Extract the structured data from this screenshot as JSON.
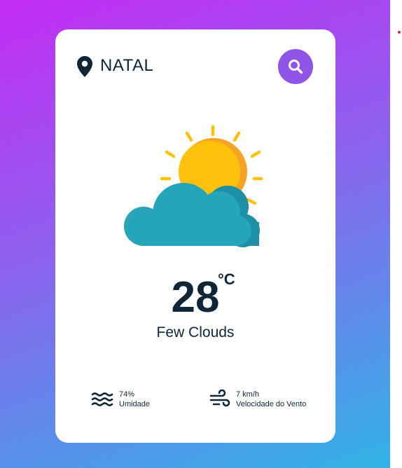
{
  "location": {
    "city": "NATAL",
    "icon": "location-pin-icon"
  },
  "search": {
    "icon": "search-icon"
  },
  "weather": {
    "icon": "sun-behind-cloud-icon",
    "temperature": "28",
    "unit": "°C",
    "description": "Few Clouds"
  },
  "details": {
    "humidity": {
      "icon": "waves-icon",
      "value": "74%",
      "label": "Umidade"
    },
    "wind": {
      "icon": "wind-icon",
      "value": "7 km/h",
      "label": "Velocidade do Vento"
    }
  },
  "colors": {
    "accent": "#9054e8",
    "text": "#0f2538",
    "sun": "#fcc10a",
    "cloud": "#26a4ba"
  }
}
